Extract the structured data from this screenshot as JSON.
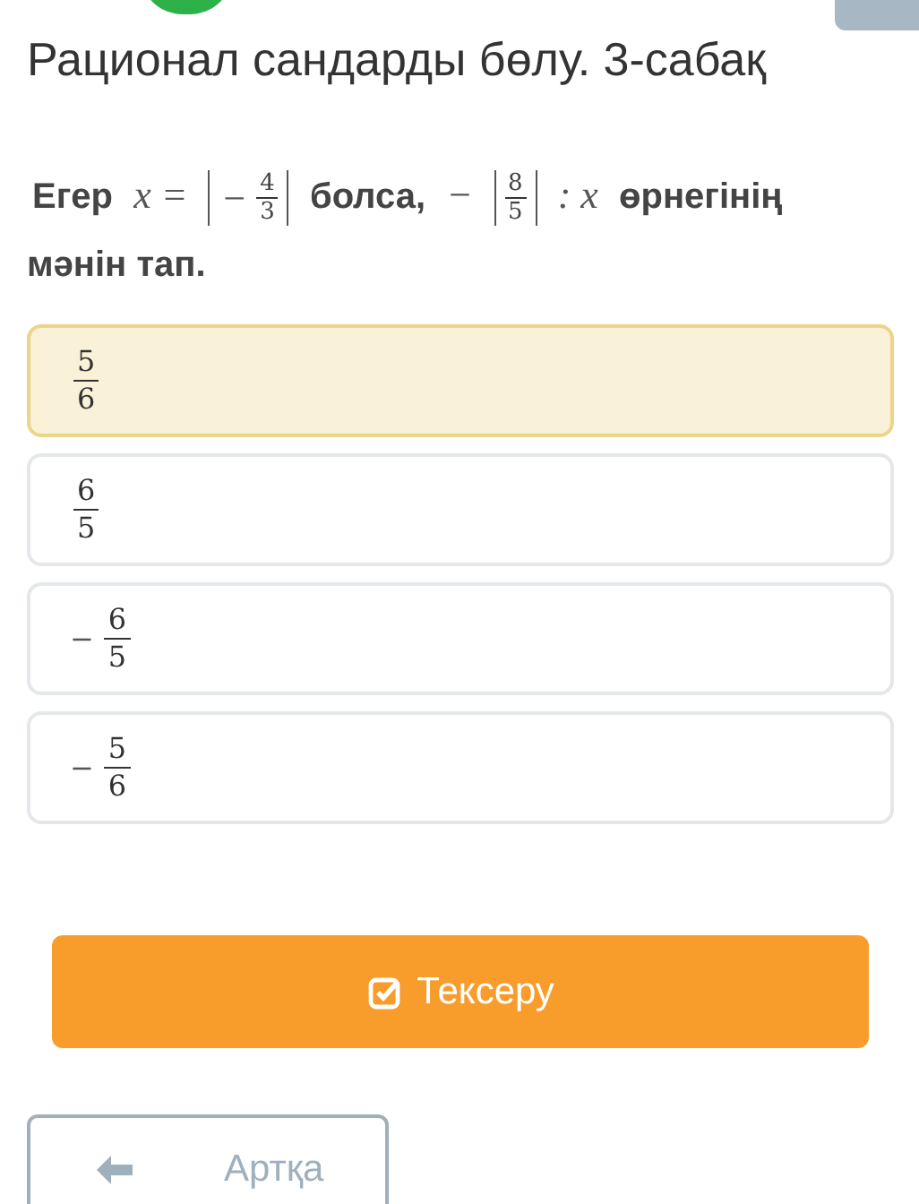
{
  "title": "Рационал сандарды бөлу. 3-сабақ",
  "question": [
    {
      "kind": "text",
      "text": "Егер"
    },
    {
      "kind": "math",
      "text": "x ="
    },
    {
      "kind": "abs",
      "parts": [
        {
          "kind": "math",
          "text": "−"
        },
        {
          "kind": "frac",
          "num": "4",
          "den": "3"
        }
      ]
    },
    {
      "kind": "text",
      "text": "болса,"
    },
    {
      "kind": "math",
      "text": "−"
    },
    {
      "kind": "abs",
      "parts": [
        {
          "kind": "frac",
          "num": "8",
          "den": "5"
        }
      ]
    },
    {
      "kind": "math",
      "text": ": x"
    },
    {
      "kind": "text",
      "text": "өрнегінің мәнін тап."
    }
  ],
  "options": [
    {
      "num": "5",
      "den": "6",
      "selected": true
    },
    {
      "num": "6",
      "den": "5",
      "selected": false
    },
    {
      "sign": "−",
      "num": "6",
      "den": "5",
      "selected": false
    },
    {
      "sign": "−",
      "num": "5",
      "den": "6",
      "selected": false
    }
  ],
  "check_button": "Тексеру",
  "back_button": "Артқа"
}
